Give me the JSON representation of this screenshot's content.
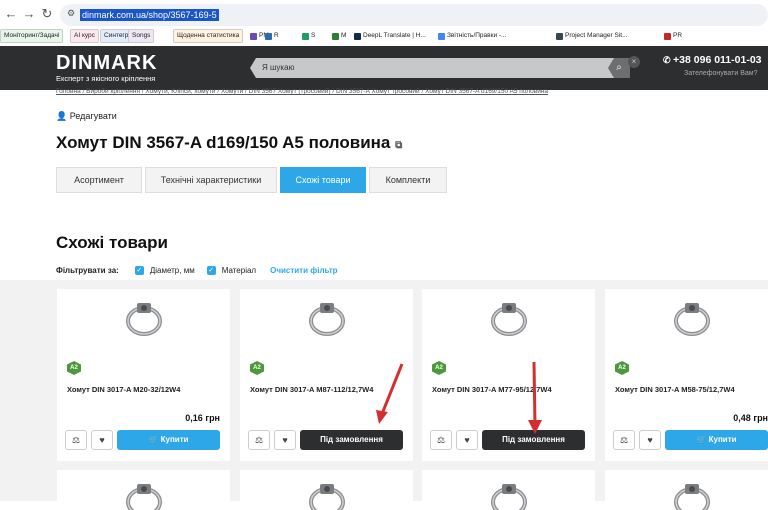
{
  "browser": {
    "url": "dinmark.com.ua/shop/3567-169-5",
    "bookmarks": [
      {
        "label": "Моніторинг/Задачі",
        "color": "#e8f5e9"
      },
      {
        "label": "AI курс",
        "color": "#fde8ef"
      },
      {
        "label": "Синтегрум",
        "color": "#e3ecfb"
      },
      {
        "label": "Songs",
        "color": "#ede7f6"
      },
      {
        "label": "Щоденна статистика",
        "color": "#fff3e0"
      },
      {
        "label": "PM",
        "color": "#6c4ab6"
      },
      {
        "label": "R",
        "color": "#2c6cb0"
      },
      {
        "label": "S",
        "color": "#1e9e63"
      },
      {
        "label": "M",
        "color": "#2e7d32"
      },
      {
        "label": "DeepL Translate | H...",
        "color": "#0f2b46"
      },
      {
        "label": "Звітність/Правки -...",
        "color": "#4285f4"
      },
      {
        "label": "Project Manager Sit...",
        "color": "#37474f"
      },
      {
        "label": "PR",
        "color": "#c62828"
      }
    ]
  },
  "header": {
    "logo": "DINMARK",
    "tagline": "Експерт з якісного кріплення",
    "search_placeholder": "Я шукаю",
    "phone": "+38 096 011-01-03",
    "callback": "Зателефонувати Вам?"
  },
  "breadcrumb": "Головна / Вироби кріплення / Хомути, Кліпси, хомути / Хомути / DIN 3567 Хомут (тросовий) / DIN 3567-A Хомут тросовий / Хомут DIN 3567-A d169/150 A5 половина",
  "page": {
    "edit_label": "Редагувати",
    "title": "Хомут DIN 3567-A d169/150 A5 половина",
    "tabs": [
      "Асортимент",
      "Технічні характеристики",
      "Схожі товари",
      "Комплекти"
    ],
    "active_tab": "Схожі товари",
    "section_title": "Схожі товари",
    "filter_label": "Фільтрувати за:",
    "filters": [
      "Діаметр, мм",
      "Матеріал"
    ],
    "clear_filter": "Очистити фільтр"
  },
  "products": [
    {
      "badge": "A2",
      "name": "Хомут DIN 3017-A M20-32/12W4",
      "price": "0,16 грн",
      "button": "Купити",
      "button_style": "blue"
    },
    {
      "badge": "A2",
      "name": "Хомут DIN 3017-A M87-112/12,7W4",
      "price": "",
      "button": "Під замовлення",
      "button_style": "dark"
    },
    {
      "badge": "A2",
      "name": "Хомут DIN 3017-A M77-95/12,7W4",
      "price": "",
      "button": "Під замовлення",
      "button_style": "dark"
    },
    {
      "badge": "A2",
      "name": "Хомут DIN 3017-A M58-75/12,7W4",
      "price": "0,48 грн",
      "button": "Купити",
      "button_style": "blue"
    }
  ],
  "icons": {
    "compare": "scale-icon",
    "wishlist": "heart-icon",
    "cart": "cart-icon"
  },
  "colors": {
    "accent": "#2ea7e8",
    "dark": "#2d2e30",
    "badge": "#4a9a3a",
    "annotation_arrow": "#d32f2f"
  }
}
